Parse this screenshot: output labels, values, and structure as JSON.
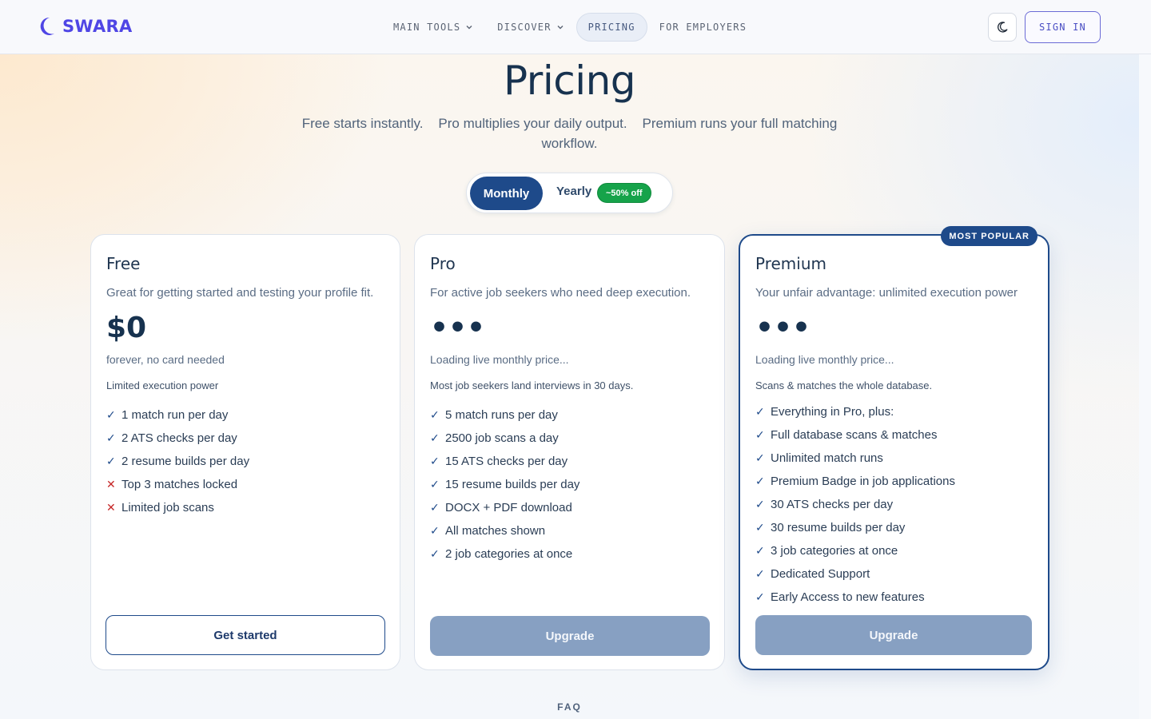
{
  "header": {
    "logo_text": "SWARA",
    "nav": [
      {
        "label": "MAIN TOOLS",
        "dropdown": true
      },
      {
        "label": "DISCOVER",
        "dropdown": true
      },
      {
        "label": "PRICING",
        "active": true
      },
      {
        "label": "FOR EMPLOYERS"
      }
    ],
    "theme_icon": "moon-icon",
    "sign_in": "SIGN IN"
  },
  "hero": {
    "title": "Pricing",
    "subtitle": "Free starts instantly.    Pro multiplies your daily output.    Premium runs your full matching workflow."
  },
  "billing_toggle": {
    "monthly": "Monthly",
    "yearly": "Yearly",
    "discount": "~50% off",
    "selected": "Monthly"
  },
  "plans": [
    {
      "name": "Free",
      "description": "Great for getting started and testing your profile fit.",
      "price": "$0",
      "period": "forever, no card needed",
      "note": "Limited execution power",
      "features": [
        {
          "text": "1 match run per day",
          "included": true
        },
        {
          "text": "2 ATS checks per day",
          "included": true
        },
        {
          "text": "2 resume builds per day",
          "included": true
        },
        {
          "text": "Top 3 matches locked",
          "included": false
        },
        {
          "text": "Limited job scans",
          "included": false
        }
      ],
      "cta": "Get started"
    },
    {
      "name": "Pro",
      "description": "For active job seekers who need deep execution.",
      "price": "•••",
      "period": "Loading live monthly price...",
      "note": "Most job seekers land interviews in 30 days.",
      "features": [
        {
          "text": "5 match runs per day",
          "included": true
        },
        {
          "text": "2500 job scans a day",
          "included": true
        },
        {
          "text": "15 ATS checks per day",
          "included": true
        },
        {
          "text": "15 resume builds per day",
          "included": true
        },
        {
          "text": "DOCX + PDF download",
          "included": true
        },
        {
          "text": "All matches shown",
          "included": true
        },
        {
          "text": "2 job categories at once",
          "included": true
        }
      ],
      "cta": "Upgrade"
    },
    {
      "name": "Premium",
      "badge": "MOST POPULAR",
      "description": "Your unfair advantage: unlimited execution power",
      "price": "•••",
      "period": "Loading live monthly price...",
      "note": "Scans & matches the whole database.",
      "features": [
        {
          "text": "Everything in Pro, plus:",
          "included": true
        },
        {
          "text": "Full database scans & matches",
          "included": true
        },
        {
          "text": "Unlimited match runs",
          "included": true
        },
        {
          "text": "Premium Badge in job applications",
          "included": true
        },
        {
          "text": "30 ATS checks per day",
          "included": true
        },
        {
          "text": "30 resume builds per day",
          "included": true
        },
        {
          "text": "3 job categories at once",
          "included": true
        },
        {
          "text": "Dedicated Support",
          "included": true
        },
        {
          "text": "Early Access to new features",
          "included": true
        }
      ],
      "cta": "Upgrade"
    }
  ],
  "faq_label": "FAQ",
  "colors": {
    "primary": "#1e4a8a",
    "brand": "#4f46e5",
    "success": "#16a34a",
    "danger": "#c62828"
  }
}
